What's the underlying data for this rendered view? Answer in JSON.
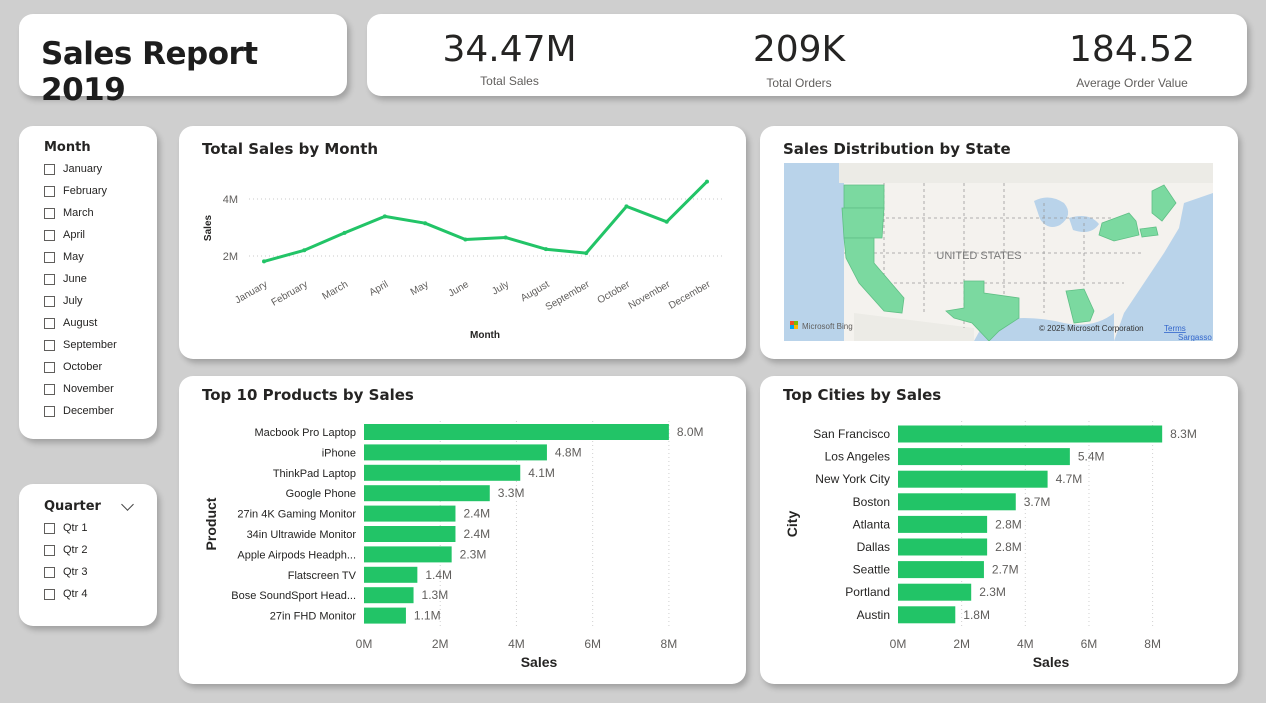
{
  "report": {
    "title": "Sales Report 2019"
  },
  "kpis": [
    {
      "value": "34.47M",
      "label": "Total Sales"
    },
    {
      "value": "209K",
      "label": "Total Orders"
    },
    {
      "value": "184.52",
      "label": "Average Order Value"
    }
  ],
  "month_slicer": {
    "title": "Month",
    "items": [
      "January",
      "February",
      "March",
      "April",
      "May",
      "June",
      "July",
      "August",
      "September",
      "October",
      "November",
      "December"
    ]
  },
  "quarter_slicer": {
    "title": "Quarter",
    "items": [
      "Qtr 1",
      "Qtr 2",
      "Qtr 3",
      "Qtr 4"
    ]
  },
  "map": {
    "title": "Sales Distribution by State",
    "country_label": "UNITED STATES",
    "provider": "Microsoft Bing",
    "copyright": "© 2025 Microsoft Corporation",
    "terms": "Terms",
    "extra_label": "Sargasso",
    "highlight_color": "#7bd9a0"
  },
  "colors": {
    "series": "#22c467",
    "accent": "#22c467"
  },
  "chart_data": [
    {
      "id": "line",
      "type": "line",
      "title": "Total Sales by Month",
      "xlabel": "Month",
      "ylabel": "Sales",
      "x": [
        "January",
        "February",
        "March",
        "April",
        "May",
        "June",
        "July",
        "August",
        "September",
        "October",
        "November",
        "December"
      ],
      "values": [
        1.81,
        2.2,
        2.81,
        3.39,
        3.15,
        2.58,
        2.65,
        2.24,
        2.1,
        3.74,
        3.2,
        4.61
      ],
      "yticks": [
        {
          "v": 2,
          "label": "2M"
        },
        {
          "v": 4,
          "label": "4M"
        }
      ],
      "ylim": [
        1.6,
        4.9
      ],
      "grid": true
    },
    {
      "id": "products",
      "type": "bar",
      "orientation": "horizontal",
      "title": "Top 10 Products by Sales",
      "xlabel": "Sales",
      "ylabel": "Product",
      "categories": [
        "Macbook Pro Laptop",
        "iPhone",
        "ThinkPad Laptop",
        "Google Phone",
        "27in 4K Gaming Monitor",
        "34in Ultrawide Monitor",
        "Apple Airpods Headph...",
        "Flatscreen TV",
        "Bose SoundSport Head...",
        "27in FHD Monitor"
      ],
      "values": [
        8.0,
        4.8,
        4.1,
        3.3,
        2.4,
        2.4,
        2.3,
        1.4,
        1.3,
        1.1
      ],
      "labels": [
        "8.0M",
        "4.8M",
        "4.1M",
        "3.3M",
        "2.4M",
        "2.4M",
        "2.3M",
        "1.4M",
        "1.3M",
        "1.1M"
      ],
      "xticks": [
        {
          "v": 0,
          "label": "0M"
        },
        {
          "v": 2,
          "label": "2M"
        },
        {
          "v": 4,
          "label": "4M"
        },
        {
          "v": 6,
          "label": "6M"
        },
        {
          "v": 8,
          "label": "8M"
        }
      ],
      "xlim": [
        0,
        9
      ]
    },
    {
      "id": "cities",
      "type": "bar",
      "orientation": "horizontal",
      "title": "Top Cities by Sales",
      "xlabel": "Sales",
      "ylabel": "City",
      "categories": [
        "San Francisco",
        "Los Angeles",
        "New York City",
        "Boston",
        "Atlanta",
        "Dallas",
        "Seattle",
        "Portland",
        "Austin"
      ],
      "values": [
        8.3,
        5.4,
        4.7,
        3.7,
        2.8,
        2.8,
        2.7,
        2.3,
        1.8
      ],
      "labels": [
        "8.3M",
        "5.4M",
        "4.7M",
        "3.7M",
        "2.8M",
        "2.8M",
        "2.7M",
        "2.3M",
        "1.8M"
      ],
      "xticks": [
        {
          "v": 0,
          "label": "0M"
        },
        {
          "v": 2,
          "label": "2M"
        },
        {
          "v": 4,
          "label": "4M"
        },
        {
          "v": 6,
          "label": "6M"
        },
        {
          "v": 8,
          "label": "8M"
        }
      ],
      "xlim": [
        0,
        9.3
      ]
    }
  ]
}
